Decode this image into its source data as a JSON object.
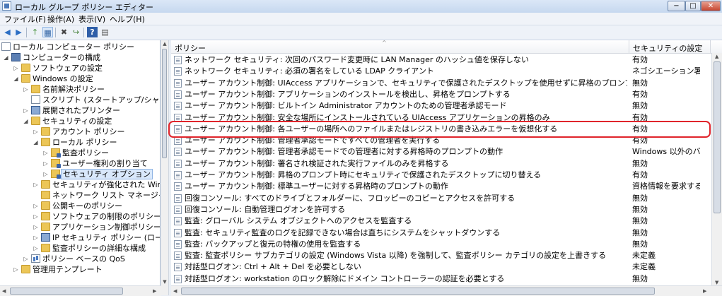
{
  "window": {
    "title": "ローカル グループ ポリシー エディター",
    "min": "−",
    "max": "□",
    "close": "✕"
  },
  "menu": [
    {
      "label": "ファイル(F)"
    },
    {
      "label": "操作(A)"
    },
    {
      "label": "表示(V)"
    },
    {
      "label": "ヘルプ(H)"
    }
  ],
  "toolbar": {
    "back": "◀",
    "forward": "▶",
    "up": "↑",
    "view": "▦",
    "delete": "✖",
    "export": "↪",
    "help": "?",
    "props": "▤"
  },
  "tree": [
    {
      "label": "ローカル コンピューター ポリシー"
    },
    {
      "label": "コンピューターの構成"
    },
    {
      "label": "ソフトウェアの設定"
    },
    {
      "label": "Windows の設定"
    },
    {
      "label": "名前解決ポリシー"
    },
    {
      "label": "スクリプト (スタートアップ/シャットダ"
    },
    {
      "label": "展開されたプリンター"
    },
    {
      "label": "セキュリティの設定"
    },
    {
      "label": "アカウント ポリシー"
    },
    {
      "label": "ローカル ポリシー"
    },
    {
      "label": "監査ポリシー"
    },
    {
      "label": "ユーザー権利の割り当て"
    },
    {
      "label": "セキュリティ オプション"
    },
    {
      "label": "セキュリティが強化された Windows"
    },
    {
      "label": "ネットワーク リスト マネージャー ポ"
    },
    {
      "label": "公開キーのポリシー"
    },
    {
      "label": "ソフトウェアの制限のポリシー"
    },
    {
      "label": "アプリケーション制御ポリシー"
    },
    {
      "label": "IP セキュリティ ポリシー (ローカル"
    },
    {
      "label": "監査ポリシーの詳細な構成"
    },
    {
      "label": "ポリシー ベースの QoS"
    },
    {
      "label": "管理用テンプレート"
    }
  ],
  "list": {
    "col_policy": "ポリシー",
    "col_setting": "セキュリティの設定",
    "sort_indicator": "^",
    "rows": [
      {
        "policy": "ネットワーク セキュリティ: 次回のパスワード変更時に LAN Manager のハッシュ値を保存しない",
        "setting": "有効"
      },
      {
        "policy": "ネットワーク セキュリティ: 必須の署名をしている LDAP クライアント",
        "setting": "ネゴシエーション署名"
      },
      {
        "policy": "ユーザー アカウント制御: UIAccess アプリケーションで、セキュリティで保護されたデスクトップを使用せずに昇格のプロンプトを表示できるようにする",
        "setting": "無効"
      },
      {
        "policy": "ユーザー アカウント制御: アプリケーションのインストールを検出し、昇格をプロンプトする",
        "setting": "有効"
      },
      {
        "policy": "ユーザー アカウント制御: ビルトイン Administrator アカウントのための管理者承認モード",
        "setting": "無効"
      },
      {
        "policy": "ユーザー アカウント制御: 安全な場所にインストールされている UIAccess アプリケーションの昇格のみ",
        "setting": "有効"
      },
      {
        "policy": "ユーザー アカウント制御: 各ユーザーの場所へのファイルまたはレジストリの書き込みエラーを仮想化する",
        "setting": "有効"
      },
      {
        "policy": "ユーザー アカウント制御: 管理者承認モードですべての管理者を実行する",
        "setting": "有効"
      },
      {
        "policy": "ユーザー アカウント制御: 管理者承認モードでの管理者に対する昇格時のプロンプトの動作",
        "setting": "Windows 以外のバイ..."
      },
      {
        "policy": "ユーザー アカウント制御: 署名され検証された実行ファイルのみを昇格する",
        "setting": "無効"
      },
      {
        "policy": "ユーザー アカウント制御: 昇格のプロンプト時にセキュリティで保護されたデスクトップに切り替える",
        "setting": "有効"
      },
      {
        "policy": "ユーザー アカウント制御: 標準ユーザーに対する昇格時のプロンプトの動作",
        "setting": "資格情報を要求する"
      },
      {
        "policy": "回復コンソール: すべてのドライブとフォルダーに、フロッピーのコピーとアクセスを許可する",
        "setting": "無効"
      },
      {
        "policy": "回復コンソール: 自動管理ログオンを許可する",
        "setting": "無効"
      },
      {
        "policy": "監査: グローバル システム オブジェクトへのアクセスを監査する",
        "setting": "無効"
      },
      {
        "policy": "監査: セキュリティ監査のログを記録できない場合は直ちにシステムをシャットダウンする",
        "setting": "無効"
      },
      {
        "policy": "監査: バックアップと復元の特権の使用を監査する",
        "setting": "無効"
      },
      {
        "policy": "監査: 監査ポリシー サブカテゴリの設定 (Windows Vista 以降) を強制して、監査ポリシー カテゴリの設定を上書きする",
        "setting": "未定義"
      },
      {
        "policy": "対話型ログオン: Ctrl + Alt + Del を必要としない",
        "setting": "未定義"
      },
      {
        "policy": "対話型ログオン: workstation のロック解除にドメイン コントローラーの認証を必要とする",
        "setting": "無効"
      }
    ]
  },
  "colors": {
    "highlight": "#e0242b",
    "selection": "#d9e8fb"
  }
}
